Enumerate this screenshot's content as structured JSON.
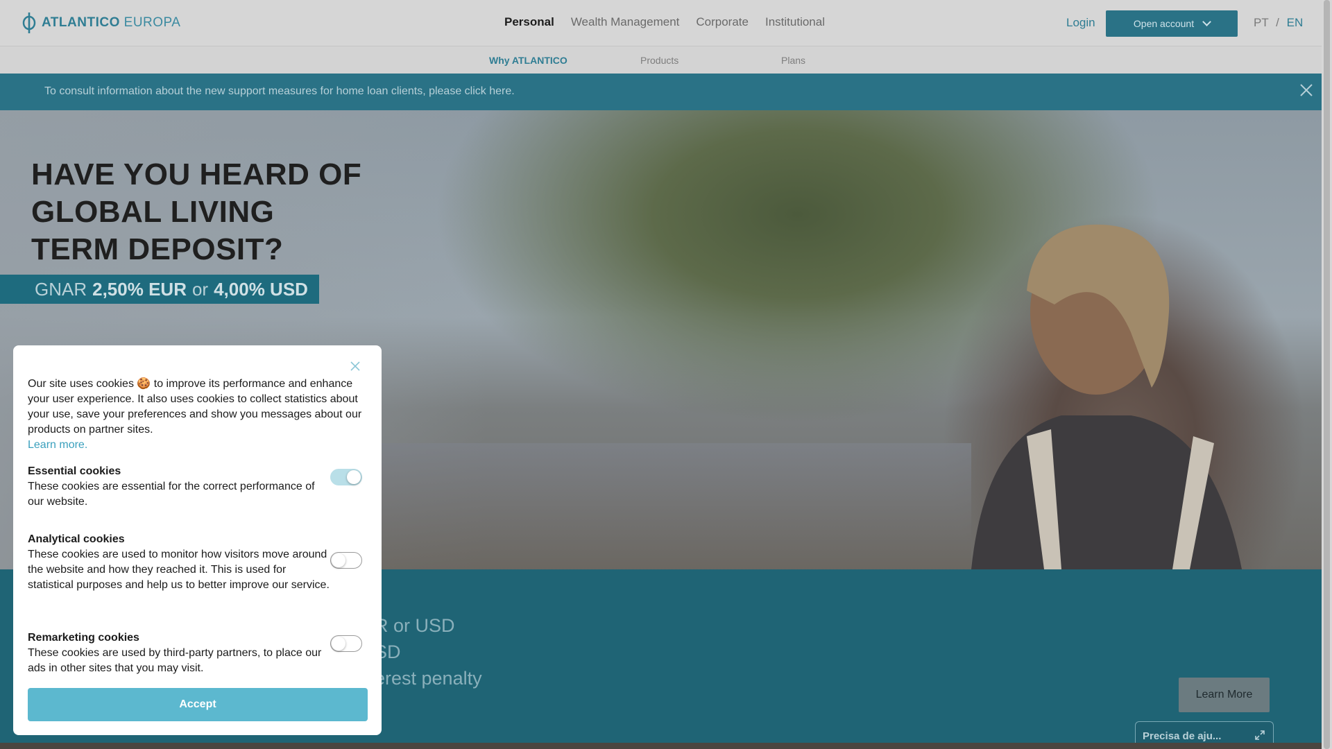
{
  "brand": {
    "name_bold": "ATLANTICO",
    "name_light": "EUROPA",
    "color": "#2f7d93"
  },
  "main_nav": [
    {
      "label": "Personal",
      "active": true
    },
    {
      "label": "Wealth Management",
      "active": false
    },
    {
      "label": "Corporate",
      "active": false
    },
    {
      "label": "Institutional",
      "active": false
    }
  ],
  "header": {
    "login_label": "Login",
    "open_account_label": "Open account",
    "lang_pt": "PT",
    "lang_sep": "/",
    "lang_en": "EN"
  },
  "sub_nav": [
    {
      "label": "Why ATLANTICO",
      "active": true
    },
    {
      "label": "Products",
      "active": false
    },
    {
      "label": "Plans",
      "active": false
    }
  ],
  "notice": {
    "text": "To consult information about the new support measures for home loan clients, please click here."
  },
  "hero": {
    "title_line1": "HAVE YOU HEARD OF",
    "title_line2": "GLOBAL LIVING",
    "title_line3": "TERM DEPOSIT?",
    "rate_prefix": "GNAR",
    "rate_eur": "2,50% EUR",
    "rate_or": "or",
    "rate_usd": "4,00% USD"
  },
  "lower": {
    "line1": "R or USD",
    "line2": "SD",
    "line3": "erest penalty",
    "learn_more_label": "Learn More"
  },
  "help_widget": {
    "label": "Precisa de aju..."
  },
  "cookie_modal": {
    "intro": "Our site uses cookies 🍪 to improve its performance and enhance your user experience. It also uses cookies to collect statistics about your use, save your preferences and show you messages about our products on partner sites.",
    "learn_more": "Learn more.",
    "sections": [
      {
        "title": "Essential cookies",
        "text": "These cookies are essential for the correct performance of our website.",
        "enabled": true
      },
      {
        "title": "Analytical cookies",
        "text": "These cookies are used to monitor how visitors move around the website and how they reached it. This is used for statistical purposes and help us to better improve our service.",
        "enabled": false
      },
      {
        "title": "Remarketing cookies",
        "text": "These cookies are used by third-party partners, to place our ads in other sites that you may visit.",
        "enabled": false
      }
    ],
    "accept_label": "Accept"
  }
}
